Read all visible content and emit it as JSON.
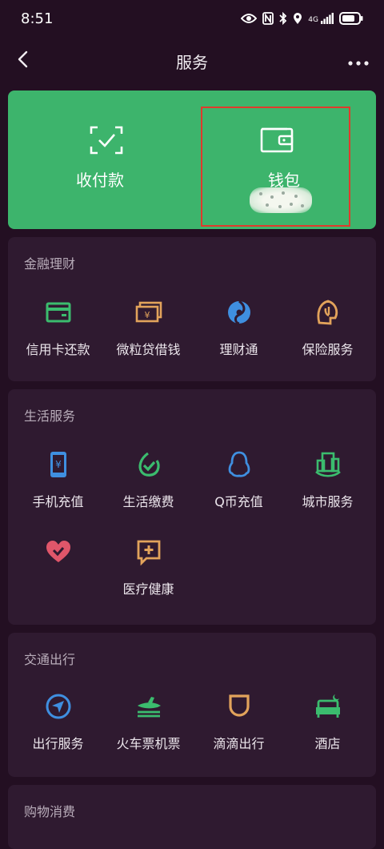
{
  "status_bar": {
    "time": "8:51",
    "network": "4G",
    "battery_icon": "battery-icon"
  },
  "nav": {
    "title": "服务",
    "back_icon": "chevron-left-icon",
    "more_icon": "more-dots-icon"
  },
  "hero": {
    "items": [
      {
        "label": "收付款",
        "icon": "scan-check-icon"
      },
      {
        "label": "钱包",
        "icon": "wallet-icon"
      }
    ]
  },
  "sections": [
    {
      "title": "金融理财",
      "items": [
        {
          "label": "信用卡还款",
          "icon": "credit-card-icon",
          "color": "#3bbc6e"
        },
        {
          "label": "微粒贷借钱",
          "icon": "yuan-notes-icon",
          "color": "#e2a35b"
        },
        {
          "label": "理财通",
          "icon": "licaitong-icon",
          "color": "#3f8fe0"
        },
        {
          "label": "保险服务",
          "icon": "umbrella-shield-icon",
          "color": "#e2a35b"
        }
      ]
    },
    {
      "title": "生活服务",
      "items": [
        {
          "label": "手机充值",
          "icon": "phone-yuan-icon",
          "color": "#3f8fe0"
        },
        {
          "label": "生活缴费",
          "icon": "check-leaf-icon",
          "color": "#3bbc6e"
        },
        {
          "label": "Q币充值",
          "icon": "penguin-icon",
          "color": "#3f8fe0"
        },
        {
          "label": "城市服务",
          "icon": "city-icon",
          "color": "#3bbc6e"
        },
        {
          "label": "",
          "icon": "heart-icon",
          "color": "#e0566a"
        },
        {
          "label": "医疗健康",
          "icon": "medical-plus-icon",
          "color": "#e2a35b"
        }
      ]
    },
    {
      "title": "交通出行",
      "items": [
        {
          "label": "出行服务",
          "icon": "navigation-icon",
          "color": "#3f8fe0"
        },
        {
          "label": "火车票机票",
          "icon": "train-plane-icon",
          "color": "#3bbc6e"
        },
        {
          "label": "滴滴出行",
          "icon": "didi-icon",
          "color": "#e2a35b"
        },
        {
          "label": "酒店",
          "icon": "hotel-bed-icon",
          "color": "#3bbc6e"
        }
      ]
    },
    {
      "title": "购物消费",
      "items": []
    }
  ]
}
